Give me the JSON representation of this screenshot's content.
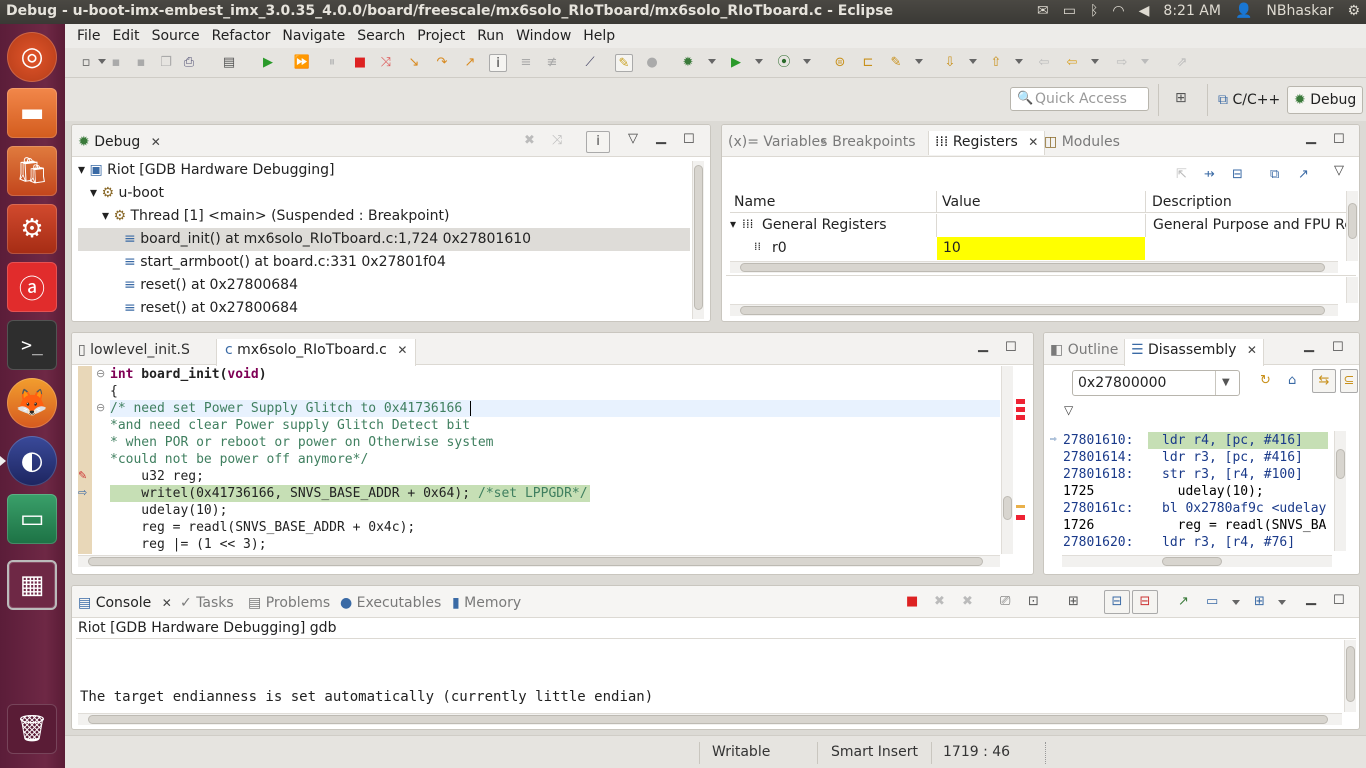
{
  "window": {
    "title": "Debug - u-boot-imx-embest_imx_3.0.35_4.0.0/board/freescale/mx6solo_RIoTboard/mx6solo_RIoTboard.c - Eclipse"
  },
  "tray": {
    "time": "8:21 AM",
    "user": "NBhaskar"
  },
  "menu": [
    "File",
    "Edit",
    "Source",
    "Refactor",
    "Navigate",
    "Search",
    "Project",
    "Run",
    "Window",
    "Help"
  ],
  "quick_access": {
    "placeholder": "Quick Access"
  },
  "perspectives": {
    "cpp": "C/C++",
    "debug": "Debug"
  },
  "debug_view": {
    "tab": "Debug",
    "rows": [
      "Riot [GDB Hardware Debugging]",
      "u-boot",
      "Thread [1] <main> (Suspended : Breakpoint)",
      "board_init() at mx6solo_RIoTboard.c:1,724 0x27801610",
      "start_armboot() at board.c:331 0x27801f04",
      "reset() at 0x27800684",
      "reset() at 0x27800684"
    ]
  },
  "registers_view": {
    "tabs": [
      "Variables",
      "Breakpoints",
      "Registers",
      "Modules"
    ],
    "columns": [
      "Name",
      "Value",
      "Description"
    ],
    "group": {
      "name": "General Registers",
      "description": "General Purpose and FPU Re"
    },
    "r0": {
      "name": "r0",
      "value": "10"
    }
  },
  "editor": {
    "tabs": [
      "lowlevel_init.S",
      "mx6solo_RIoTboard.c"
    ],
    "lines": [
      "int board_init(void)",
      "{",
      "/* need set Power Supply Glitch to 0x41736166",
      "*and need clear Power supply Glitch Detect bit",
      "* when POR or reboot or power on Otherwise system",
      "*could not be power off anymore*/",
      "    u32 reg;",
      "    writel(0x41736166, SNVS_BASE_ADDR + 0x64);",
      "    udelay(10);",
      "    reg = readl(SNVS_BASE_ADDR + 0x4c);",
      "    reg |= (1 << 3);"
    ],
    "inline_comment": "/*set LPPGDR*/"
  },
  "disassembly_view": {
    "tabs": [
      "Outline",
      "Disassembly"
    ],
    "address": "0x27800000",
    "rows": [
      {
        "addr": "27801610:",
        "code": "ldr r4, [pc, #416]"
      },
      {
        "addr": "27801614:",
        "code": "ldr r3, [pc, #416]"
      },
      {
        "addr": "27801618:",
        "code": "str r3, [r4, #100]"
      },
      {
        "addr": "1725",
        "code": "  udelay(10);"
      },
      {
        "addr": "2780161c:",
        "code": "bl 0x2780af9c <udelay"
      },
      {
        "addr": "1726",
        "code": "  reg = readl(SNVS_BA"
      },
      {
        "addr": "27801620:",
        "code": "ldr r3, [r4, #76]"
      }
    ]
  },
  "console_view": {
    "tabs": [
      "Console",
      "Tasks",
      "Problems",
      "Executables",
      "Memory"
    ],
    "header": "Riot [GDB Hardware Debugging] gdb",
    "output": "The target endianness is set automatically (currently little endian)"
  },
  "status": {
    "mode": "Writable",
    "insert": "Smart Insert",
    "position": "1719 : 46"
  },
  "colors": {
    "current_line": "#c6dfb5",
    "register_highlight": "#ffff00",
    "comment": "#3f7f5f",
    "keyword": "#7f0055"
  }
}
